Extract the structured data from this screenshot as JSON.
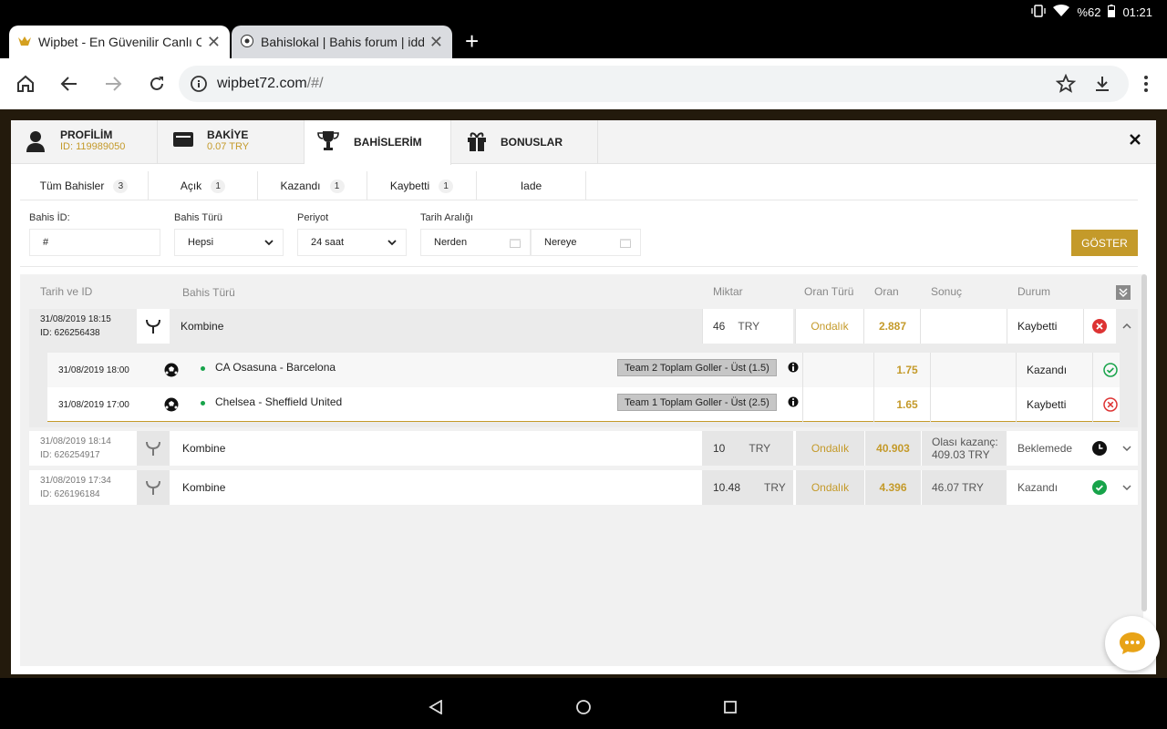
{
  "status": {
    "battery": "%62",
    "time": "01:21"
  },
  "browser": {
    "tabs": [
      {
        "title": "Wipbet - En Güvenilir Canlı Ca"
      },
      {
        "title": "Bahislokal | Bahis forum | idd"
      }
    ],
    "url_main": "wipbet72.com",
    "url_path": "/#/"
  },
  "modal": {
    "tabs": [
      {
        "label": "PROFİLİM",
        "sub": "ID: 119989050"
      },
      {
        "label": "BAKİYE",
        "sub": "0.07 TRY"
      },
      {
        "label": "BAHİSLERİM",
        "sub": ""
      },
      {
        "label": "BONUSLAR",
        "sub": ""
      }
    ],
    "filter_tabs": [
      {
        "label": "Tüm Bahisler",
        "count": "3"
      },
      {
        "label": "Açık",
        "count": "1"
      },
      {
        "label": "Kazandı",
        "count": "1"
      },
      {
        "label": "Kaybetti",
        "count": "1"
      },
      {
        "label": "Iade",
        "count": ""
      }
    ],
    "filters": {
      "bahis_id_label": "Bahis İD:",
      "bahis_id_value": "#",
      "bahis_turu_label": "Bahis Türü",
      "bahis_turu_value": "Hepsi",
      "periyot_label": "Periyot",
      "periyot_value": "24 saat",
      "tarih_label": "Tarih Aralığı",
      "from_placeholder": "Nerden",
      "to_placeholder": "Nereye",
      "show_button": "GÖSTER"
    },
    "table": {
      "headers": [
        "Tarih ve ID",
        "Bahis Türü",
        "Miktar",
        "Oran Türü",
        "Oran",
        "Sonuç",
        "Durum"
      ],
      "rows": [
        {
          "date": "31/08/2019 18:15",
          "id": "ID: 626256438",
          "type": "Kombine",
          "amount": "46",
          "currency": "TRY",
          "odds_type": "Ondalık",
          "odds": "2.887",
          "result_label": "",
          "result_value": "",
          "status": "Kaybetti",
          "status_icon": "lost-icon"
        },
        {
          "date": "31/08/2019 18:14",
          "id": "ID: 626254917",
          "type": "Kombine",
          "amount": "10",
          "currency": "TRY",
          "odds_type": "Ondalık",
          "odds": "40.903",
          "result_label": "Olası kazanç:",
          "result_value": "409.03 TRY",
          "status": "Beklemede",
          "status_icon": "pending-icon"
        },
        {
          "date": "31/08/2019 17:34",
          "id": "ID: 626196184",
          "type": "Kombine",
          "amount": "10.48",
          "currency": "TRY",
          "odds_type": "Ondalık",
          "odds": "4.396",
          "result_label": "",
          "result_value": "46.07 TRY",
          "status": "Kazandı",
          "status_icon": "won-icon"
        }
      ],
      "details": [
        {
          "date": "31/08/2019 18:00",
          "match": "CA Osasuna - Barcelona",
          "market": "Team 2 Toplam Goller - Üst (1.5)",
          "odds": "1.75",
          "status": "Kazandı"
        },
        {
          "date": "31/08/2019 17:00",
          "match": "Chelsea - Sheffield United",
          "market": "Team 1 Toplam Goller - Üst (2.5)",
          "odds": "1.65",
          "status": "Kaybetti"
        }
      ]
    }
  },
  "colors": {
    "accent": "#c49a2a",
    "lost": "#d33",
    "won": "#17a34a"
  }
}
